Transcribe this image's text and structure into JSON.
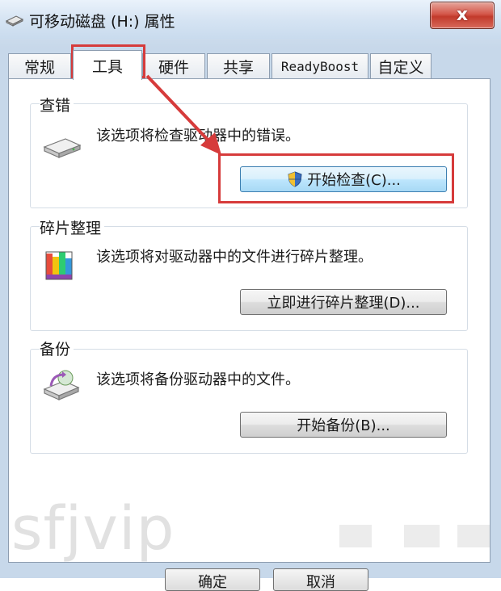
{
  "window": {
    "title": "可移动磁盘 (H:) 属性",
    "close_label": "x"
  },
  "tabs": [
    {
      "label": "常规",
      "active": false
    },
    {
      "label": "工具",
      "active": true
    },
    {
      "label": "硬件",
      "active": false
    },
    {
      "label": "共享",
      "active": false
    },
    {
      "label": "ReadyBoost",
      "active": false
    },
    {
      "label": "自定义",
      "active": false
    }
  ],
  "groups": {
    "error_check": {
      "title": "查错",
      "description": "该选项将检查驱动器中的错误。",
      "button": "开始检查(C)...",
      "icon": "drive-icon"
    },
    "defrag": {
      "title": "碎片整理",
      "description": "该选项将对驱动器中的文件进行碎片整理。",
      "button": "立即进行碎片整理(D)...",
      "icon": "defrag-icon"
    },
    "backup": {
      "title": "备份",
      "description": "该选项将备份驱动器中的文件。",
      "button": "开始备份(B)...",
      "icon": "backup-icon"
    }
  },
  "footer": {
    "ok_label": "确定",
    "cancel_label": "取消"
  },
  "watermark": "sfjvip",
  "colors": {
    "annotation": "#d63b3b",
    "close_button": "#c23a2b",
    "highlight_button": "#bee6fd"
  }
}
